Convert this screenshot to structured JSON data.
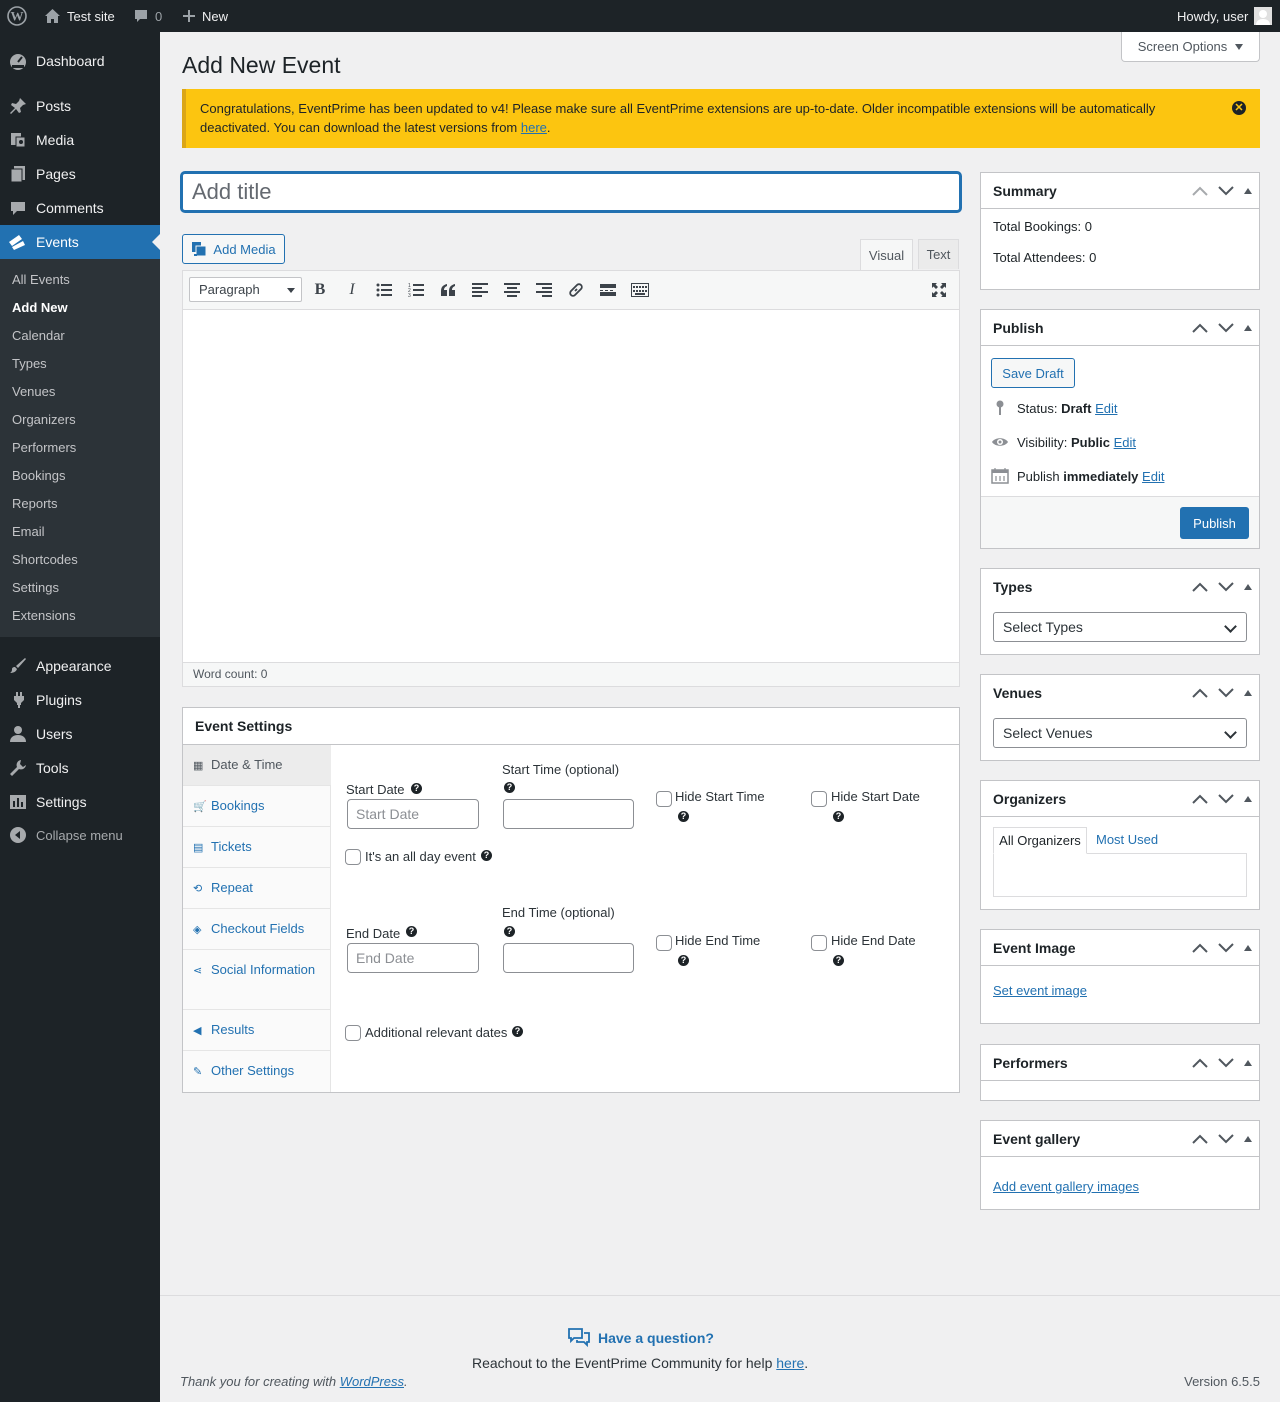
{
  "adminbar": {
    "site": "Test site",
    "comments": "0",
    "new": "New",
    "howdy": "Howdy, user"
  },
  "menu": {
    "dashboard": "Dashboard",
    "posts": "Posts",
    "media": "Media",
    "pages": "Pages",
    "comments": "Comments",
    "events": "Events",
    "appearance": "Appearance",
    "plugins": "Plugins",
    "users": "Users",
    "tools": "Tools",
    "settings": "Settings",
    "collapse": "Collapse menu",
    "sub": [
      "All Events",
      "Add New",
      "Calendar",
      "Types",
      "Venues",
      "Organizers",
      "Performers",
      "Bookings",
      "Reports",
      "Email",
      "Shortcodes",
      "Settings",
      "Extensions"
    ]
  },
  "page": {
    "title": "Add New Event",
    "screen_options": "Screen Options"
  },
  "notice": {
    "text": "Congratulations, EventPrime has been updated to v4! Please make sure all EventPrime extensions are up-to-date. Older incompatible extensions will be automatically deactivated. You can download the latest versions from ",
    "link": "here",
    "end": "."
  },
  "editor": {
    "title_placeholder": "Add title",
    "add_media": "Add Media",
    "tab_visual": "Visual",
    "tab_text": "Text",
    "format": "Paragraph",
    "word_count": "Word count: 0"
  },
  "event_settings": {
    "title": "Event Settings",
    "tabs": [
      "Date & Time",
      "Bookings",
      "Tickets",
      "Repeat",
      "Checkout Fields",
      "Social Information",
      "Results",
      "Other Settings"
    ],
    "start_date": "Start Date",
    "start_date_ph": "Start Date",
    "start_time": "Start Time (optional)",
    "hide_start_time": "Hide Start Time",
    "hide_start_date": "Hide Start Date",
    "all_day": "It's an all day event",
    "end_date": "End Date",
    "end_date_ph": "End Date",
    "end_time": "End Time (optional)",
    "hide_end_time": "Hide End Time",
    "hide_end_date": "Hide End Date",
    "additional": "Additional relevant dates"
  },
  "summary": {
    "title": "Summary",
    "bookings": "Total Bookings: 0",
    "attendees": "Total Attendees: 0"
  },
  "publish": {
    "title": "Publish",
    "save_draft": "Save Draft",
    "status_label": "Status:",
    "status": "Draft",
    "visibility_label": "Visibility:",
    "visibility": "Public",
    "publish_label": "Publish",
    "publish_when": "immediately",
    "edit": "Edit",
    "button": "Publish"
  },
  "types": {
    "title": "Types",
    "select": "Select Types"
  },
  "venues": {
    "title": "Venues",
    "select": "Select Venues"
  },
  "organizers": {
    "title": "Organizers",
    "tab_all": "All Organizers",
    "tab_used": "Most Used"
  },
  "event_image": {
    "title": "Event Image",
    "link": "Set event image"
  },
  "performers": {
    "title": "Performers"
  },
  "gallery": {
    "title": "Event gallery",
    "link": "Add event gallery images"
  },
  "footer": {
    "question": "Have a question?",
    "help": "Reachout to the EventPrime Community for help ",
    "help_link": "here",
    "help_end": ".",
    "thanks": "Thank you for creating with ",
    "wp": "WordPress",
    "thanks_end": ".",
    "version": "Version 6.5.5"
  },
  "colors": {
    "accent": "#2271b1",
    "sidebar": "#1d2327",
    "notice": "#fcc510"
  }
}
